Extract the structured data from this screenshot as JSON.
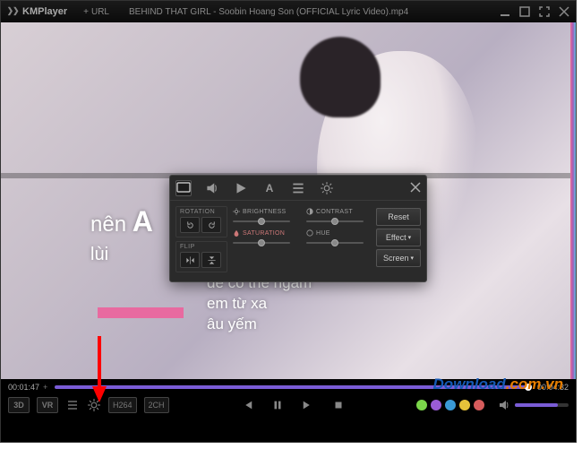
{
  "titlebar": {
    "logo": "KMPlayer",
    "url_label": "URL",
    "title": "BEHIND THAT GIRL - Soobin Hoang Son (OFFICIAL Lyric Video).mp4"
  },
  "lyrics": {
    "line1_prefix": "nên ",
    "line1_big": "A",
    "line2": "lùi",
    "center1": "để có thể ngắm",
    "center2": "em từ xa",
    "center3": "âu yếm"
  },
  "panel": {
    "tabs": [
      "screen",
      "audio",
      "play",
      "subtitle",
      "playlist",
      "settings"
    ],
    "rotation_label": "ROTATION",
    "flip_label": "FLIP",
    "brightness_label": "BRIGHTNESS",
    "contrast_label": "CONTRAST",
    "saturation_label": "SATURATION",
    "hue_label": "HUE",
    "reset": "Reset",
    "effect": "Effect",
    "screen": "Screen",
    "sliders": {
      "brightness": 50,
      "contrast": 50,
      "saturation": 50,
      "hue": 50
    }
  },
  "playback": {
    "current": "00:01:47",
    "total": "00:04:32",
    "badges": {
      "threeD": "3D",
      "vr": "VR",
      "codec": "H264",
      "channels": "2CH"
    },
    "dots": [
      "#7bd64a",
      "#9a5cd6",
      "#3a9ad6",
      "#e6c23a",
      "#d65c5c"
    ],
    "volume_pct": 80
  },
  "watermark": {
    "part1": "Download",
    "part2": ".com.vn"
  }
}
